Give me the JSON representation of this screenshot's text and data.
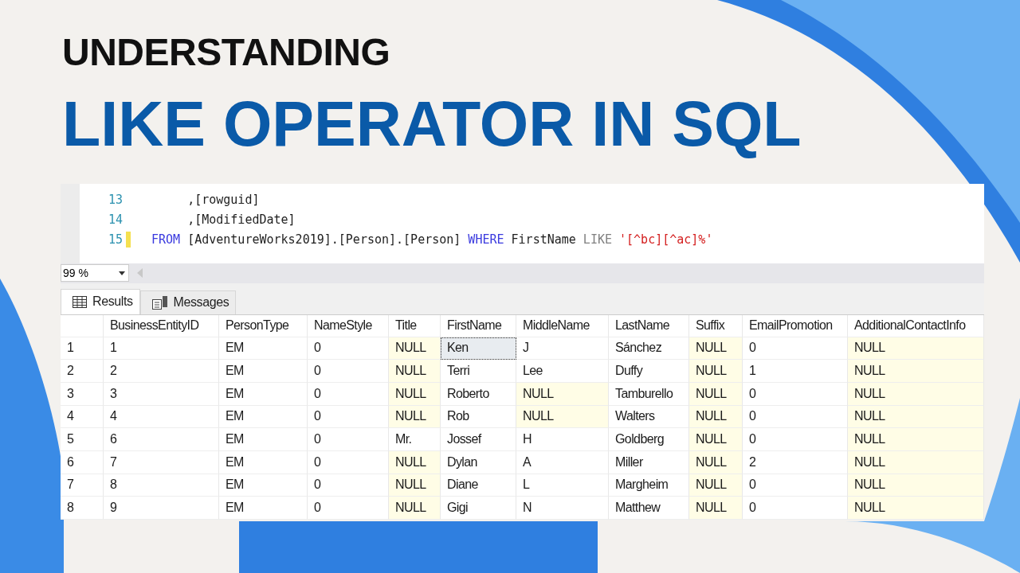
{
  "heading": {
    "kicker": "UNDERSTANDING",
    "title": "LIKE OPERATOR IN SQL"
  },
  "editor": {
    "lines": [
      {
        "number": "13",
        "changed": false,
        "tokens": [
          {
            "kind": "text",
            "text": "     ,[rowguid]"
          }
        ]
      },
      {
        "number": "14",
        "changed": false,
        "tokens": [
          {
            "kind": "text",
            "text": "     ,[ModifiedDate]"
          }
        ]
      },
      {
        "number": "15",
        "changed": true,
        "tokens": [
          {
            "kind": "keyword",
            "text": "FROM"
          },
          {
            "kind": "text",
            "text": " [AdventureWorks2019].[Person].[Person] "
          },
          {
            "kind": "keyword",
            "text": "WHERE"
          },
          {
            "kind": "text",
            "text": " FirstName "
          },
          {
            "kind": "operator",
            "text": "LIKE "
          },
          {
            "kind": "string",
            "text": "'[^bc][^ac]%'"
          }
        ]
      }
    ]
  },
  "zoom": {
    "value": "99 %"
  },
  "tabs": [
    {
      "label": "Results",
      "selected": true
    },
    {
      "label": "Messages",
      "selected": false
    }
  ],
  "table": {
    "columns": [
      "BusinessEntityID",
      "PersonType",
      "NameStyle",
      "Title",
      "FirstName",
      "MiddleName",
      "LastName",
      "Suffix",
      "EmailPromotion",
      "AdditionalContactInfo"
    ],
    "rows": [
      {
        "number": "1",
        "cells": [
          {
            "text": "1",
            "null": false,
            "selected": false
          },
          {
            "text": "EM",
            "null": false,
            "selected": false
          },
          {
            "text": "0",
            "null": false,
            "selected": false
          },
          {
            "text": "NULL",
            "null": true,
            "selected": false
          },
          {
            "text": "Ken",
            "null": false,
            "selected": true
          },
          {
            "text": "J",
            "null": false,
            "selected": false
          },
          {
            "text": "Sánchez",
            "null": false,
            "selected": false
          },
          {
            "text": "NULL",
            "null": true,
            "selected": false
          },
          {
            "text": "0",
            "null": false,
            "selected": false
          },
          {
            "text": "NULL",
            "null": true,
            "selected": false
          }
        ]
      },
      {
        "number": "2",
        "cells": [
          {
            "text": "2",
            "null": false,
            "selected": false
          },
          {
            "text": "EM",
            "null": false,
            "selected": false
          },
          {
            "text": "0",
            "null": false,
            "selected": false
          },
          {
            "text": "NULL",
            "null": true,
            "selected": false
          },
          {
            "text": "Terri",
            "null": false,
            "selected": false
          },
          {
            "text": "Lee",
            "null": false,
            "selected": false
          },
          {
            "text": "Duffy",
            "null": false,
            "selected": false
          },
          {
            "text": "NULL",
            "null": true,
            "selected": false
          },
          {
            "text": "1",
            "null": false,
            "selected": false
          },
          {
            "text": "NULL",
            "null": true,
            "selected": false
          }
        ]
      },
      {
        "number": "3",
        "cells": [
          {
            "text": "3",
            "null": false,
            "selected": false
          },
          {
            "text": "EM",
            "null": false,
            "selected": false
          },
          {
            "text": "0",
            "null": false,
            "selected": false
          },
          {
            "text": "NULL",
            "null": true,
            "selected": false
          },
          {
            "text": "Roberto",
            "null": false,
            "selected": false
          },
          {
            "text": "NULL",
            "null": true,
            "selected": false
          },
          {
            "text": "Tamburello",
            "null": false,
            "selected": false
          },
          {
            "text": "NULL",
            "null": true,
            "selected": false
          },
          {
            "text": "0",
            "null": false,
            "selected": false
          },
          {
            "text": "NULL",
            "null": true,
            "selected": false
          }
        ]
      },
      {
        "number": "4",
        "cells": [
          {
            "text": "4",
            "null": false,
            "selected": false
          },
          {
            "text": "EM",
            "null": false,
            "selected": false
          },
          {
            "text": "0",
            "null": false,
            "selected": false
          },
          {
            "text": "NULL",
            "null": true,
            "selected": false
          },
          {
            "text": "Rob",
            "null": false,
            "selected": false
          },
          {
            "text": "NULL",
            "null": true,
            "selected": false
          },
          {
            "text": "Walters",
            "null": false,
            "selected": false
          },
          {
            "text": "NULL",
            "null": true,
            "selected": false
          },
          {
            "text": "0",
            "null": false,
            "selected": false
          },
          {
            "text": "NULL",
            "null": true,
            "selected": false
          }
        ]
      },
      {
        "number": "5",
        "cells": [
          {
            "text": "6",
            "null": false,
            "selected": false
          },
          {
            "text": "EM",
            "null": false,
            "selected": false
          },
          {
            "text": "0",
            "null": false,
            "selected": false
          },
          {
            "text": "Mr.",
            "null": false,
            "selected": false
          },
          {
            "text": "Jossef",
            "null": false,
            "selected": false
          },
          {
            "text": "H",
            "null": false,
            "selected": false
          },
          {
            "text": "Goldberg",
            "null": false,
            "selected": false
          },
          {
            "text": "NULL",
            "null": true,
            "selected": false
          },
          {
            "text": "0",
            "null": false,
            "selected": false
          },
          {
            "text": "NULL",
            "null": true,
            "selected": false
          }
        ]
      },
      {
        "number": "6",
        "cells": [
          {
            "text": "7",
            "null": false,
            "selected": false
          },
          {
            "text": "EM",
            "null": false,
            "selected": false
          },
          {
            "text": "0",
            "null": false,
            "selected": false
          },
          {
            "text": "NULL",
            "null": true,
            "selected": false
          },
          {
            "text": "Dylan",
            "null": false,
            "selected": false
          },
          {
            "text": "A",
            "null": false,
            "selected": false
          },
          {
            "text": "Miller",
            "null": false,
            "selected": false
          },
          {
            "text": "NULL",
            "null": true,
            "selected": false
          },
          {
            "text": "2",
            "null": false,
            "selected": false
          },
          {
            "text": "NULL",
            "null": true,
            "selected": false
          }
        ]
      },
      {
        "number": "7",
        "cells": [
          {
            "text": "8",
            "null": false,
            "selected": false
          },
          {
            "text": "EM",
            "null": false,
            "selected": false
          },
          {
            "text": "0",
            "null": false,
            "selected": false
          },
          {
            "text": "NULL",
            "null": true,
            "selected": false
          },
          {
            "text": "Diane",
            "null": false,
            "selected": false
          },
          {
            "text": "L",
            "null": false,
            "selected": false
          },
          {
            "text": "Margheim",
            "null": false,
            "selected": false
          },
          {
            "text": "NULL",
            "null": true,
            "selected": false
          },
          {
            "text": "0",
            "null": false,
            "selected": false
          },
          {
            "text": "NULL",
            "null": true,
            "selected": false
          }
        ]
      },
      {
        "number": "8",
        "cells": [
          {
            "text": "9",
            "null": false,
            "selected": false
          },
          {
            "text": "EM",
            "null": false,
            "selected": false
          },
          {
            "text": "0",
            "null": false,
            "selected": false
          },
          {
            "text": "NULL",
            "null": true,
            "selected": false
          },
          {
            "text": "Gigi",
            "null": false,
            "selected": false
          },
          {
            "text": "N",
            "null": false,
            "selected": false
          },
          {
            "text": "Matthew",
            "null": false,
            "selected": false
          },
          {
            "text": "NULL",
            "null": true,
            "selected": false
          },
          {
            "text": "0",
            "null": false,
            "selected": false
          },
          {
            "text": "NULL",
            "null": true,
            "selected": false
          }
        ]
      }
    ]
  }
}
